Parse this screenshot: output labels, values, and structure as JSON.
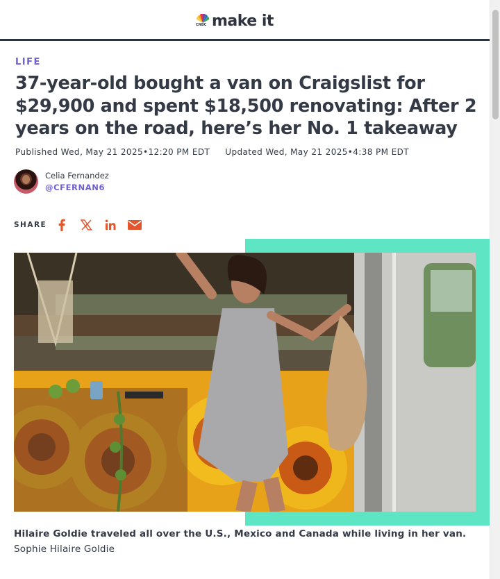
{
  "header": {
    "logo_text": "make it",
    "logo_badge": "CNBC"
  },
  "article": {
    "section": "LIFE",
    "headline": "37-year-old bought a van on Craigslist for $29,900 and spent $18,500 renovating: After 2 years on the road, here’s her No. 1 takeaway",
    "published": "Published Wed, May 21 2025•12:20 PM EDT",
    "updated": "Updated Wed, May 21 2025•4:38 PM EDT"
  },
  "author": {
    "name": "Celia Fernandez",
    "handle": "@CFERNAN6"
  },
  "share": {
    "label": "SHARE",
    "icons": [
      "facebook-icon",
      "x-icon",
      "linkedin-icon",
      "email-icon"
    ]
  },
  "image": {
    "caption": "Hilaire Goldie traveled all over the U.S., Mexico and Canada while living in her van.",
    "credit": "Sophie Hilaire Goldie"
  },
  "colors": {
    "accent": "#5ee5c4",
    "link": "#6e5fd3",
    "text": "#333a45",
    "facebook": "#e2562e",
    "share_icons": "#e2562e"
  }
}
